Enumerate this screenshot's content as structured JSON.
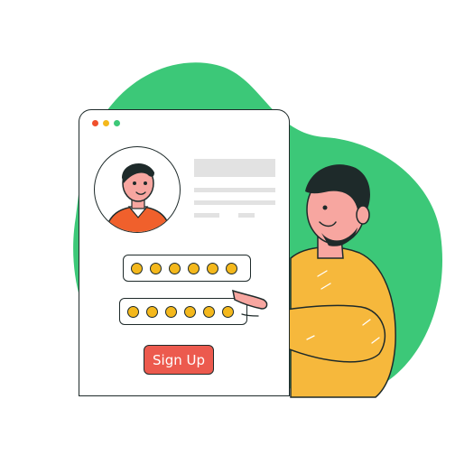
{
  "colors": {
    "blob": "#3cc878",
    "accent": "#ec5a4e",
    "dot_red": "#f0502c",
    "dot_yellow": "#f4b81c",
    "dot_green": "#3cc878",
    "bead": "#f4b81c",
    "shirt": "#f6b83c",
    "skin": "#f7a6a0",
    "hair": "#1e2a2a",
    "avatar_shirt": "#f0602c"
  },
  "window": {
    "traffic_lights": [
      "close-dot",
      "minimize-dot",
      "maximize-dot"
    ]
  },
  "form": {
    "field_one_mask_count": 6,
    "field_two_mask_count": 6,
    "signup_label": "Sign Up"
  }
}
